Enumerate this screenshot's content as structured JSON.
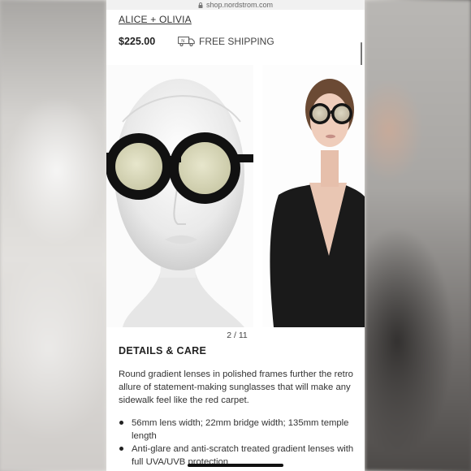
{
  "browser": {
    "url": "shop.nordstrom.com"
  },
  "product": {
    "brand": "ALICE + OLIVIA",
    "price": "$225.00",
    "shipping": "FREE SHIPPING"
  },
  "gallery": {
    "pager": "2 / 11",
    "images": [
      {
        "name": "mannequin-with-sunglasses"
      },
      {
        "name": "model-with-sunglasses"
      }
    ]
  },
  "details": {
    "heading": "DETAILS & CARE",
    "description": "Round gradient lenses in polished frames further the retro allure of statement-making sunglasses that will make any sidewalk feel like the red carpet.",
    "bullets": [
      "56mm lens width; 22mm bridge width; 135mm temple length",
      "Anti-glare and anti-scratch treated gradient lenses with full UVA/UVB protection"
    ]
  },
  "colors": {
    "background_page": "#ffffff",
    "text_primary": "#222222",
    "frame_black": "#111111",
    "lens_tint": "#d9d8b8"
  },
  "icons": {
    "lock": "lock-icon",
    "truck": "truck-icon"
  }
}
